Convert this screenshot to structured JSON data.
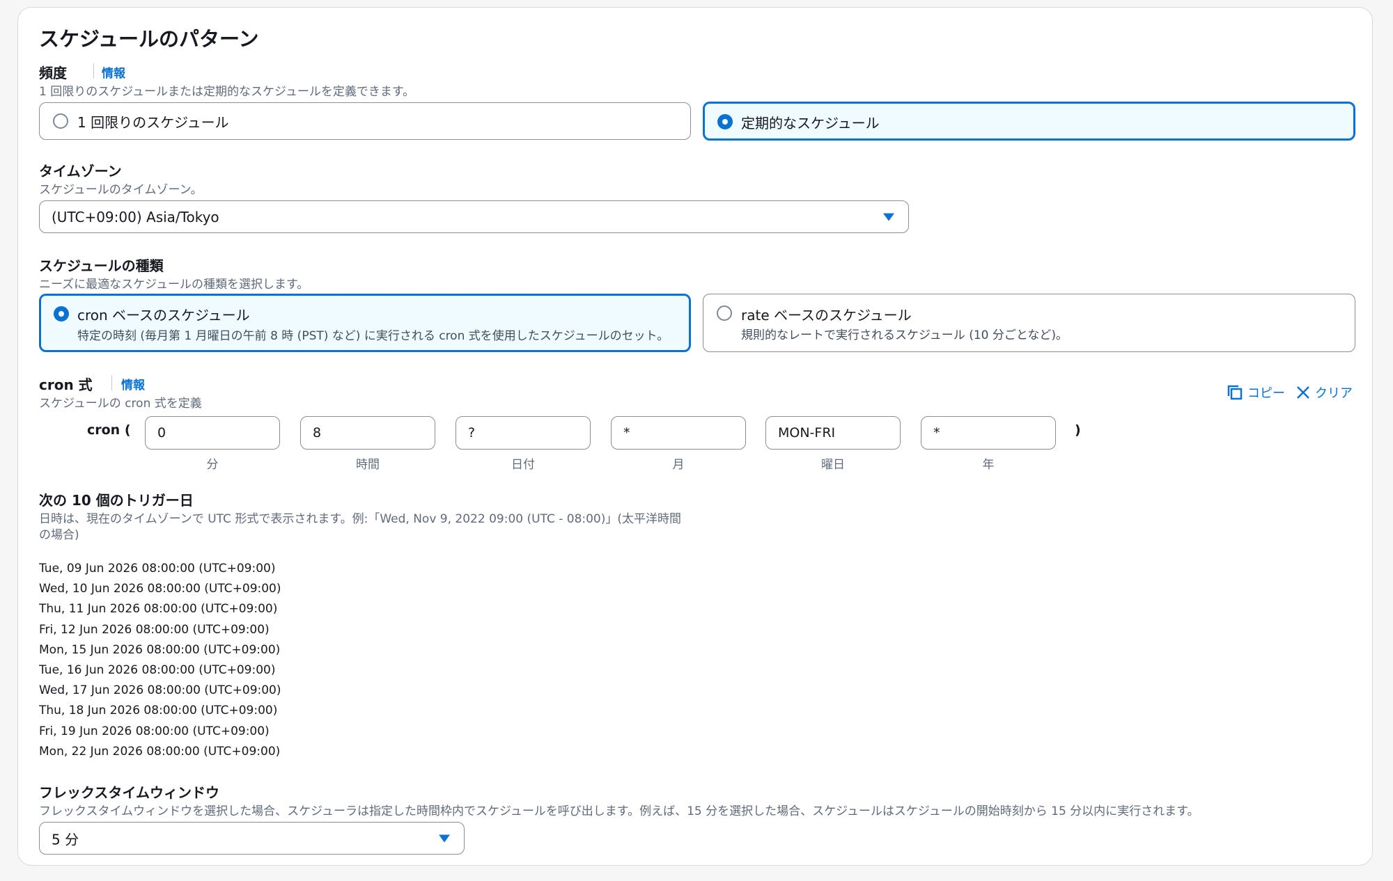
{
  "page": {
    "title": "スケジュールのパターン"
  },
  "frequency": {
    "label": "頻度",
    "info": "情報",
    "description": "1 回限りのスケジュールまたは定期的なスケジュールを定義できます。",
    "options": [
      {
        "label": "1 回限りのスケジュール",
        "selected": false
      },
      {
        "label": "定期的なスケジュール",
        "selected": true
      }
    ]
  },
  "timezone": {
    "label": "タイムゾーン",
    "description": "スケジュールのタイムゾーン。",
    "value": "(UTC+09:00) Asia/Tokyo"
  },
  "schedule_type": {
    "label": "スケジュールの種類",
    "description": "ニーズに最適なスケジュールの種類を選択します。",
    "options": [
      {
        "label": "cron ベースのスケジュール",
        "sub": "特定の時刻 (毎月第 1 月曜日の午前 8 時 (PST) など) に実行される cron 式を使用したスケジュールのセット。",
        "selected": true
      },
      {
        "label": "rate ベースのスケジュール",
        "sub": "規則的なレートで実行されるスケジュール (10 分ごとなど)。",
        "selected": false
      }
    ]
  },
  "cron": {
    "label": "cron 式",
    "info": "情報",
    "description": "スケジュールの cron 式を定義",
    "copy_label": "コピー",
    "clear_label": "クリア",
    "open": "cron (",
    "close": ")",
    "fields": [
      {
        "value": "0",
        "label": "分"
      },
      {
        "value": "8",
        "label": "時間"
      },
      {
        "value": "?",
        "label": "日付"
      },
      {
        "value": "*",
        "label": "月"
      },
      {
        "value": "MON-FRI",
        "label": "曜日"
      },
      {
        "value": "*",
        "label": "年"
      }
    ]
  },
  "triggers": {
    "label": "次の 10 個のトリガー日",
    "description_line1": "日時は、現在のタイムゾーンで UTC 形式で表示されます。例:「Wed, Nov 9, 2022 09:00 (UTC - 08:00)」(太平洋時間",
    "description_line2": "の場合)",
    "dates": [
      "Tue, 09 Jun 2026 08:00:00 (UTC+09:00)",
      "Wed, 10 Jun 2026 08:00:00 (UTC+09:00)",
      "Thu, 11 Jun 2026 08:00:00 (UTC+09:00)",
      "Fri, 12 Jun 2026 08:00:00 (UTC+09:00)",
      "Mon, 15 Jun 2026 08:00:00 (UTC+09:00)",
      "Tue, 16 Jun 2026 08:00:00 (UTC+09:00)",
      "Wed, 17 Jun 2026 08:00:00 (UTC+09:00)",
      "Thu, 18 Jun 2026 08:00:00 (UTC+09:00)",
      "Fri, 19 Jun 2026 08:00:00 (UTC+09:00)",
      "Mon, 22 Jun 2026 08:00:00 (UTC+09:00)"
    ]
  },
  "flex_window": {
    "label": "フレックスタイムウィンドウ",
    "description": "フレックスタイムウィンドウを選択した場合、スケジューラは指定した時間枠内でスケジュールを呼び出します。例えば、15 分を選択した場合、スケジュールはスケジュールの開始時刻から 15 分以内に実行されます。",
    "value": "5 分"
  },
  "colors": {
    "accent": "#0972d3",
    "selected_bg": "#f0fbff",
    "border": "#8c8c94",
    "muted_text": "#5f6b7a"
  }
}
